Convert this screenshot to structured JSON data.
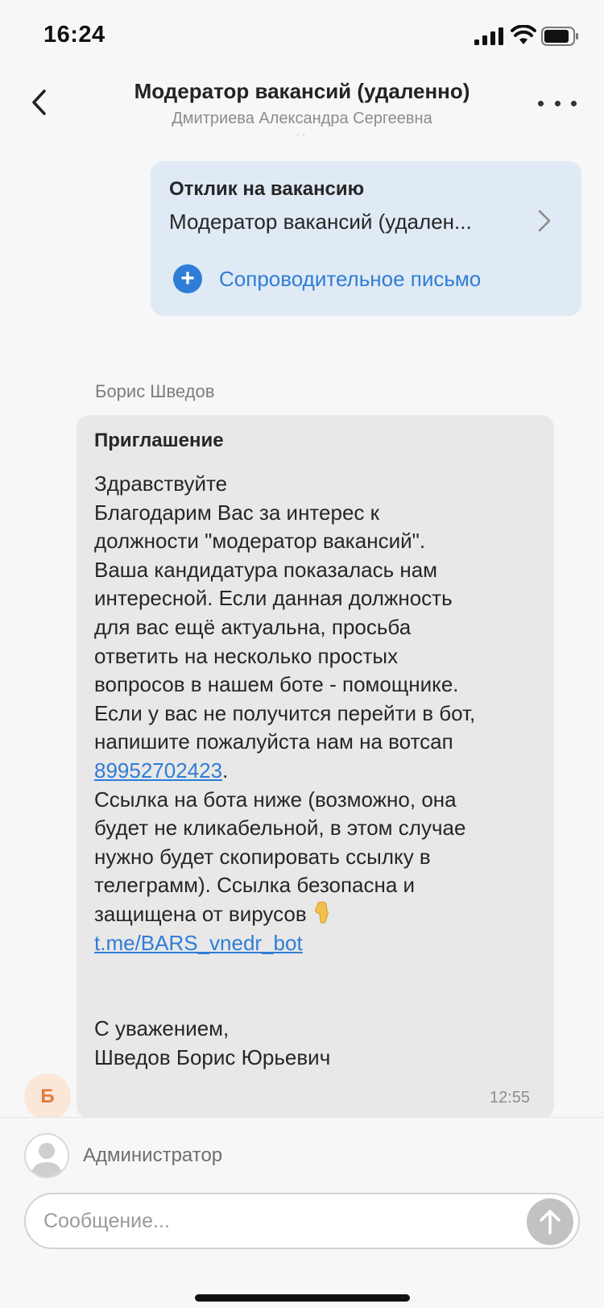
{
  "status_bar": {
    "time": "16:24"
  },
  "header": {
    "title": "Модератор вакансий (удаленно)",
    "subtitle": "Дмитриева Александра Сергеевна",
    "dots": "··"
  },
  "response_card": {
    "title": "Отклик на вакансию",
    "vacancy": "Модератор вакансий (удален...",
    "cover_letter_label": "Сопроводительное письмо",
    "plus_glyph": "+"
  },
  "message": {
    "sender_name": "Борис Шведов",
    "avatar_letter": "Б",
    "title": "Приглашение",
    "greeting": "Здравствуйте",
    "body_part1": "Благодарим Вас за интерес к\nдолжности \"модератор вакансий\".\nВаша кандидатура показалась нам\nинтересной. Если данная должность\nдля вас ещё актуальна, просьба\nответить на несколько простых\nвопросов в нашем боте - помощнике.\nЕсли у вас не получится перейти в бот,\nнапишите пожалуйста нам на вотсап\n",
    "phone_link": "89952702423",
    "body_part2": ".\nСсылка на бота ниже (возможно, она\nбудет не кликабельной, в этом случае\nнужно будет скопировать ссылку в\nтелеграмм). Ссылка безопасна и\nзащищена от вирусов",
    "bot_link": "t.me/BARS_vnedr_bot",
    "signoff": "С уважением,\nШведов Борис Юрьевич",
    "time": "12:55"
  },
  "composer": {
    "admin_label": "Администратор",
    "input_placeholder": "Сообщение...",
    "input_value": ""
  },
  "icons": {
    "back": "chevron-left-icon",
    "more": "more-horizontal-icon",
    "chevron": "chevron-right-icon",
    "plus": "plus-circle-icon",
    "send": "arrow-up-icon",
    "emoji": "pointing-down-hand-emoji",
    "admin_avatar": "user-placeholder-icon"
  },
  "colors": {
    "accent": "#2f7dd6",
    "card_bg": "#dfeaf5",
    "bubble_bg": "#e8e8e8",
    "avatar_bg": "#fbe6d8",
    "avatar_fg": "#e07b3c"
  }
}
